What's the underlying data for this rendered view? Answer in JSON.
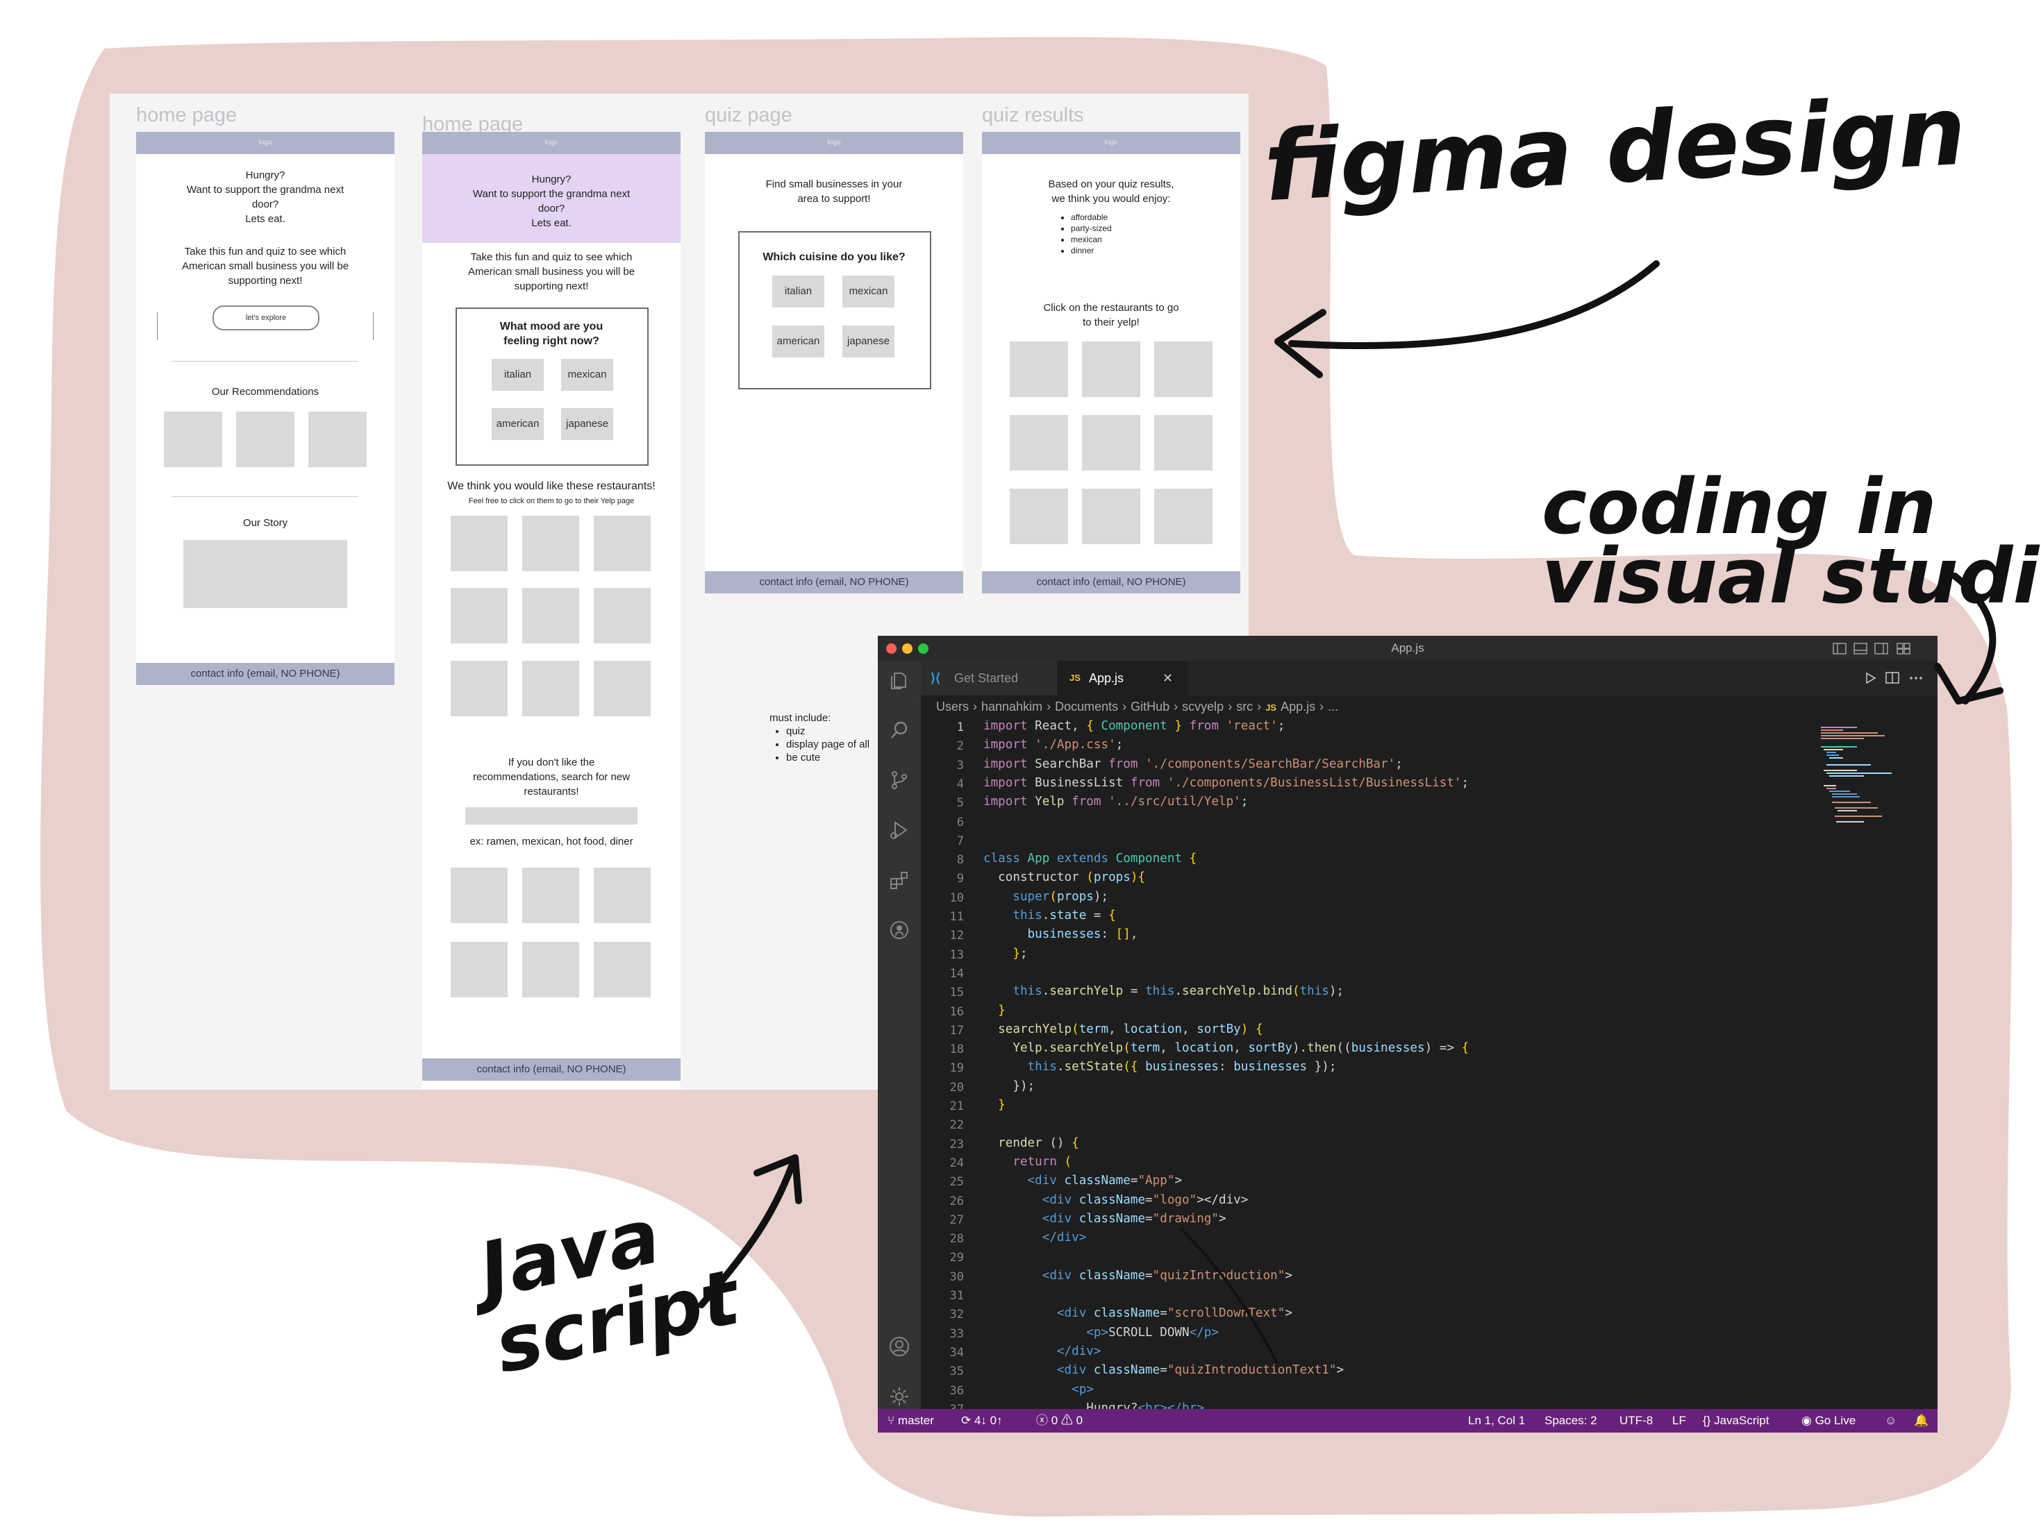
{
  "colors": {
    "blob": "#e8d0cc",
    "status_bar": "#68217a",
    "figma_header": "#aeb3c9",
    "highlight": "#e4d3f3"
  },
  "annotations": {
    "figma": "figma design",
    "coding": "coding in\nvisual studio",
    "js": "Java\nscript"
  },
  "figma": {
    "frames": [
      {
        "title": "home page",
        "header": "logo",
        "intro1": "Hungry?\nWant to support the grandma next\ndoor?\nLets eat.",
        "intro2": "Take this fun and quiz to see which\nAmerican small business you will be\nsupporting next!",
        "button": "let's explore",
        "recs": "Our Recommendations",
        "story": "Our Story",
        "footer": "contact info (email, NO PHONE)"
      },
      {
        "title": "home page",
        "header": "logo",
        "intro1": "Hungry?\nWant to support the grandma next\ndoor?\nLets eat.",
        "intro2": "Take this fun and quiz to see which\nAmerican small business you will be\nsupporting next!",
        "question": "What mood are you\nfeeling right now?",
        "choices": [
          "italian",
          "mexican",
          "american",
          "japanese"
        ],
        "suggest": "We think you would like these restaurants!",
        "suggest_sub": "Feel free to click on them to go to their Yelp page",
        "search_text": "If you don't like the\nrecommendations, search for new\nrestaurants!",
        "search_ex": "ex: ramen, mexican, hot food, diner",
        "footer": "contact info (email, NO PHONE)"
      },
      {
        "title": "quiz page",
        "header": "logo",
        "intro": "Find small businesses in your\narea to support!",
        "question": "Which cuisine do you like?",
        "choices": [
          "italian",
          "mexican",
          "american",
          "japanese"
        ],
        "footer": "contact info (email, NO PHONE)"
      },
      {
        "title": "quiz results",
        "header": "logo",
        "intro": "Based on your quiz results,\nwe think you would enjoy:",
        "bullets": [
          "affordable",
          "party-sized",
          "mexican",
          "dinner"
        ],
        "click": "Click on the restaurants to go\nto their yelp!",
        "footer": "contact info (email, NO PHONE)"
      }
    ],
    "notes": {
      "title": "must include:",
      "items": [
        "quiz",
        "display page of all",
        "be cute"
      ]
    }
  },
  "vscode": {
    "title": "App.js",
    "tabs": [
      {
        "label": "Get Started"
      },
      {
        "label": "App.js",
        "badge": "JS",
        "close": "✕"
      }
    ],
    "breadcrumb": [
      "Users",
      "hannahkim",
      "Documents",
      "GitHub",
      "scvyelp",
      "src",
      "JS",
      "App.js",
      "..."
    ],
    "line_numbers": [
      "1",
      "2",
      "3",
      "4",
      "5",
      "6",
      "7",
      "8",
      "9",
      "10",
      "11",
      "12",
      "13",
      "14",
      "15",
      "16",
      "17",
      "18",
      "19",
      "20",
      "21",
      "22",
      "23",
      "24",
      "25",
      "26",
      "27",
      "28",
      "29",
      "30",
      "31",
      "32",
      "33",
      "34",
      "35",
      "36",
      "37"
    ],
    "code": {
      "l1": [
        "import",
        " React, ",
        "{",
        " Component ",
        "}",
        " from ",
        "'react'",
        ";"
      ],
      "l2": [
        "import",
        " ",
        "'./App.css'",
        ";"
      ],
      "l3": [
        "import",
        " SearchBar ",
        "from",
        " ",
        "'./components/SearchBar/SearchBar'",
        ";"
      ],
      "l4": [
        "import",
        " BusinessList ",
        "from",
        " ",
        "'./components/BusinessList/BusinessList'",
        ";"
      ],
      "l5": [
        "import",
        " Yelp ",
        "from",
        " ",
        "'../src/util/Yelp'",
        ";"
      ],
      "l8": [
        "class",
        " App ",
        "extends",
        " Component ",
        "{"
      ],
      "l9": [
        "  constructor ",
        "(",
        "props",
        ")",
        "{"
      ],
      "l10": [
        "    super",
        "(",
        "props",
        ");"
      ],
      "l11": [
        "    this",
        ".",
        "state",
        " = ",
        "{"
      ],
      "l12": [
        "      businesses",
        ": ",
        "[]",
        ","
      ],
      "l13": [
        "    ",
        "}",
        ";"
      ],
      "l15": [
        "    this",
        ".",
        "searchYelp",
        " = ",
        "this",
        ".",
        "searchYelp",
        ".",
        "bind",
        "(",
        "this",
        ");"
      ],
      "l16": [
        "  }"
      ],
      "l17": [
        "  searchYelp",
        "(",
        "term",
        ", ",
        "location",
        ", ",
        "sortBy",
        ") ",
        "{"
      ],
      "l18": [
        "    Yelp",
        ".",
        "searchYelp",
        "(",
        "term",
        ", ",
        "location",
        ", ",
        "sortBy",
        ").",
        "then",
        "((",
        "businesses",
        ") => ",
        "{"
      ],
      "l19": [
        "      this",
        ".",
        "setState",
        "({ ",
        "businesses",
        ": ",
        "businesses",
        " });"
      ],
      "l20": [
        "    });"
      ],
      "l21": [
        "  }"
      ],
      "l23": [
        "  render ",
        "() ",
        "{"
      ],
      "l24": [
        "    return ",
        "("
      ],
      "l25": [
        "      <div ",
        "className",
        "=",
        "\"App\"",
        ">"
      ],
      "l26": [
        "        <div ",
        "className",
        "=",
        "\"logo\"",
        "></div>"
      ],
      "l27": [
        "        <div ",
        "className",
        "=",
        "\"drawing\"",
        ">"
      ],
      "l28": [
        "        </div>"
      ],
      "l30": [
        "        <div ",
        "className",
        "=",
        "\"quizIntroduction\"",
        ">"
      ],
      "l32": [
        "          <div ",
        "className",
        "=",
        "\"scrollDownText\"",
        ">"
      ],
      "l33": [
        "              <p>",
        "SCROLL DOWN",
        "</p>"
      ],
      "l34": [
        "          </div>"
      ],
      "l35": [
        "          <div ",
        "className",
        "=",
        "\"quizIntroductionText1\"",
        ">"
      ],
      "l36": [
        "            <p>"
      ],
      "l37": [
        "              Hungry?",
        "<br></br>"
      ]
    },
    "status": {
      "branch": "master",
      "sync": "4↓ 0↑",
      "errors": "0",
      "warnings": "0",
      "position": "Ln 1, Col 1",
      "spaces": "Spaces: 2",
      "encoding": "UTF-8",
      "eol": "LF",
      "language": "JavaScript",
      "golive": "Go Live"
    }
  }
}
